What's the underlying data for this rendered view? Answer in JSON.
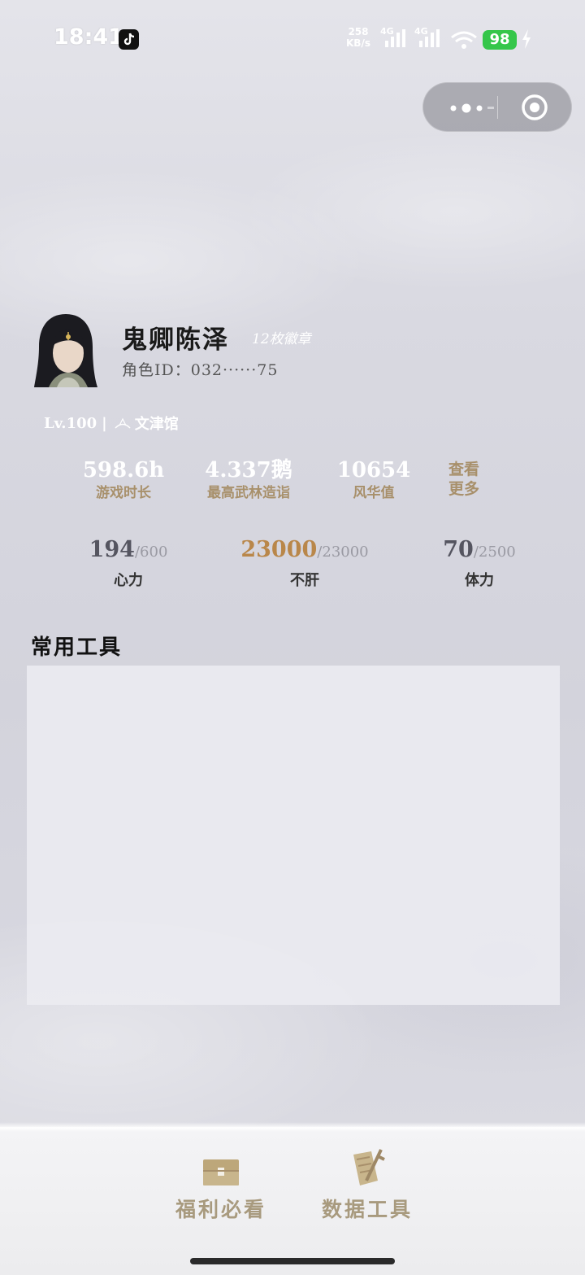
{
  "status_bar": {
    "time": "18:41",
    "net_speed_value": "258",
    "net_speed_unit": "KB/s",
    "signal1_label": "4G",
    "signal2_label": "4G",
    "battery": "98"
  },
  "profile": {
    "name": "鬼卿陈泽",
    "badges": "12枚徽章",
    "role_id": "角色ID：032······75",
    "level": "Lv.100",
    "separator": "|",
    "school": "文津馆"
  },
  "stats": [
    {
      "value": "598.6h",
      "label": "游戏时长"
    },
    {
      "value": "4.337鹅",
      "label": "最高武林造诣"
    },
    {
      "value": "10654",
      "label": "风华值"
    }
  ],
  "see_more": "查看更多",
  "resources": [
    {
      "current": "194",
      "max": "/600",
      "label": "心力"
    },
    {
      "current": "23000",
      "max": "/23000",
      "label": "不肝"
    },
    {
      "current": "70",
      "max": "/2500",
      "label": "体力"
    }
  ],
  "tools_section_title": "常用工具",
  "bottom_nav": [
    {
      "label": "福利必看",
      "icon": "treasure-chest-icon"
    },
    {
      "label": "数据工具",
      "icon": "scroll-sword-icon"
    }
  ],
  "colors": {
    "accent_gold": "#a8906b",
    "highlight_orange": "#b9874a",
    "battery_green": "#35c64a"
  }
}
